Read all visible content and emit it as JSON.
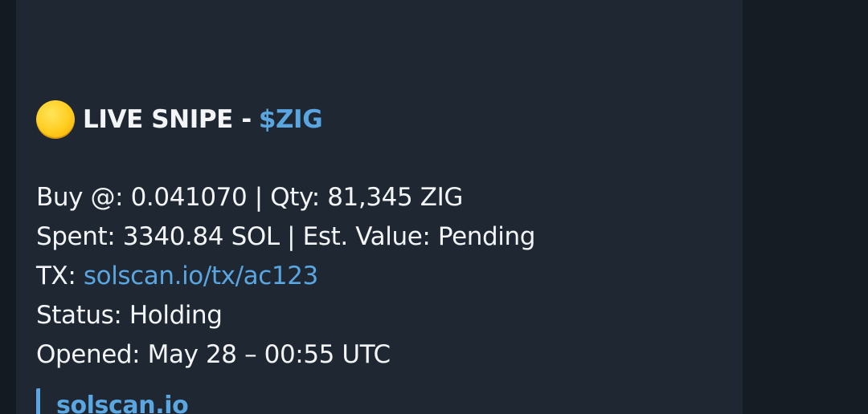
{
  "message": {
    "title_prefix": "LIVE SNIPE - ",
    "title_token": "$ZIG",
    "icon": "yellow-circle-icon",
    "buy_line": "Buy @: 0.041070 | Qty: 81,345 ZIG",
    "spent_line": "Spent: 3340.84 SOL | Est. Value: Pending",
    "tx_label": "TX: ",
    "tx_link": "solscan.io/tx/ac123",
    "status_line": "Status: Holding",
    "opened_line": "Opened: May 28 – 00:55 UTC"
  },
  "link_preview": {
    "site_name": "solscan.io"
  },
  "colors": {
    "bubble_bg": "#1e2732",
    "accent": "#5aa6e0",
    "text": "#f2f4f6"
  }
}
